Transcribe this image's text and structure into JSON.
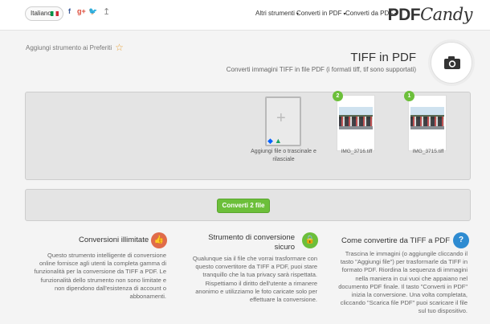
{
  "header": {
    "logo_main": "PDF",
    "logo_script": "Candy",
    "nav": [
      "Converti da PDF",
      "Converti in PDF",
      "Altri strumenti"
    ],
    "language": "Italiano",
    "social": [
      "🐦",
      "g+",
      "f"
    ],
    "upload_icon": "↥"
  },
  "tool": {
    "favorite_label": "Aggiungi strumento ai Preferiti",
    "title": "TIFF in PDF",
    "subtitle": "Converti immagini TIFF in file PDF (i formati tiff, tif sono supportati)",
    "icon": "camera-icon"
  },
  "files": [
    {
      "name": "IMG_3715.tiff",
      "index": "1"
    },
    {
      "name": "IMG_3716.tiff",
      "index": "2"
    }
  ],
  "add_file": {
    "label": "Aggiungi file o trascinale e rilasciale"
  },
  "convert": {
    "label": "Converti 2 file"
  },
  "info": [
    {
      "title": "Come convertire da TIFF a PDF",
      "body": "Trascina le immagini (o aggiungile cliccando il tasto \"Aggiungi file\") per trasformarle da TIFF in formato PDF. Riordina la sequenza di immagini nella maniera in cui vuoi che appaiano nel documento PDF finale. Il tasto \"Converti in PDF\" inizia la conversione. Una volta completata, cliccando \"Scarica file PDF\" puoi scaricare il file sul tuo dispositivo.",
      "icon": "question-icon",
      "glyph": "?"
    },
    {
      "title": "Strumento di conversione sicuro",
      "body": "Qualunque sia il file che vorrai trasformare con questo convertitore da TIFF a PDF, puoi stare tranquillo che la tua privacy sarà rispettata. Rispettiamo il diritto dell'utente a rimanere anonimo e utilizziamo le foto caricate solo per effettuare la conversione.",
      "icon": "lock-icon",
      "glyph": "🔒"
    },
    {
      "title": "Conversioni illimitate",
      "body": "Questo strumento intelligente di conversione online fornisce agli utenti la completa gamma di funzionalità per la conversione da TIFF a PDF. Le funzionalità dello strumento non sono limitate e non dipendono dall'esistenza di account o abbonamenti.",
      "icon": "thumbs-up-icon",
      "glyph": "👍"
    }
  ],
  "colors": {
    "accent_green": "#6cbf3a",
    "blue": "#2e8bd1",
    "orange": "#e06b4a"
  }
}
